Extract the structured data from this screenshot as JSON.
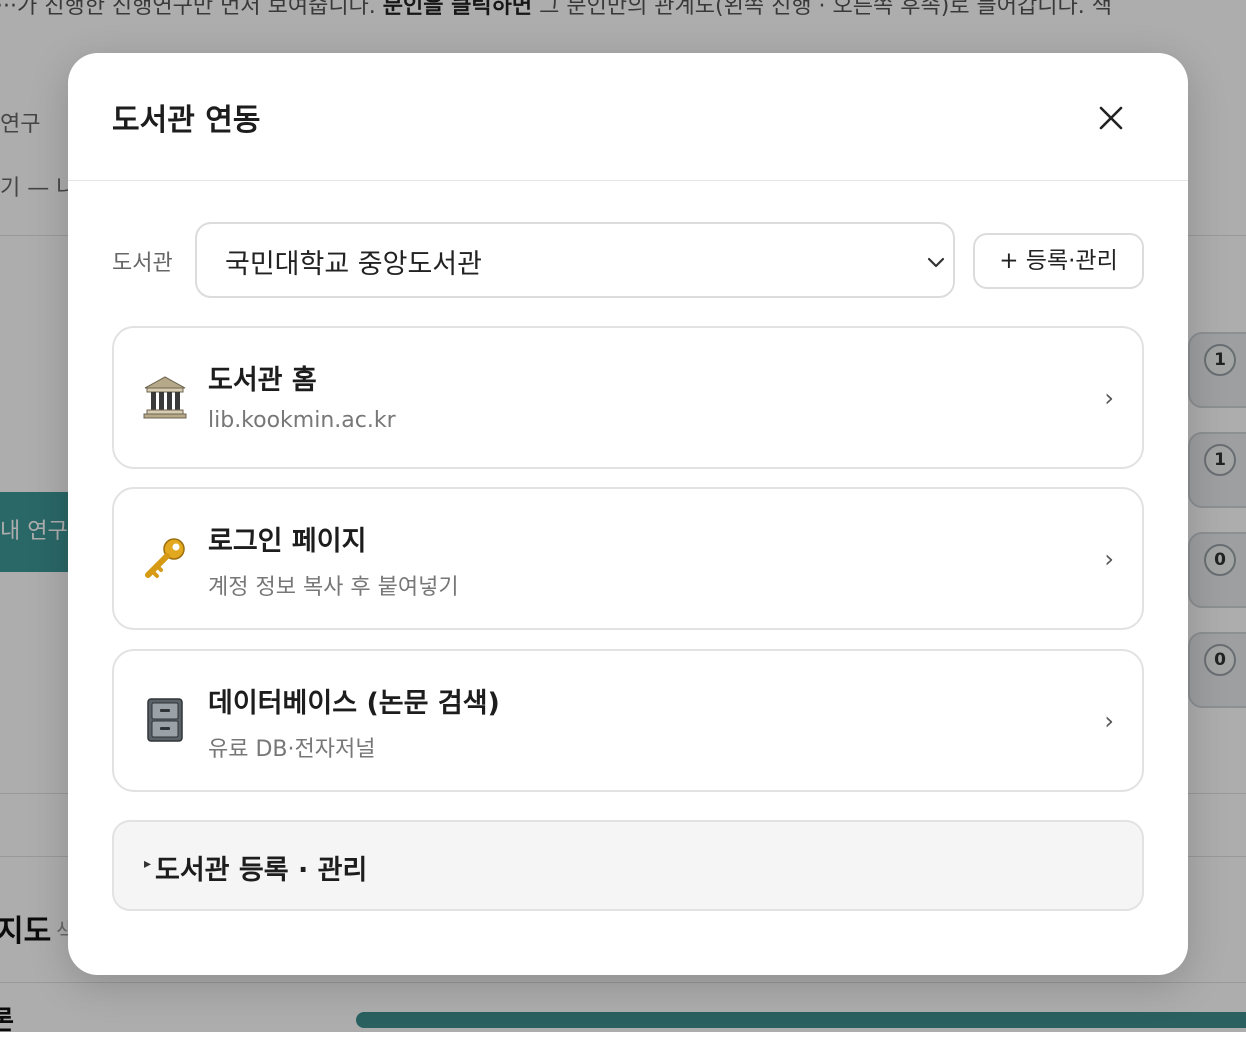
{
  "background": {
    "top_text_prefix": "···가 진행한 진행연구만 먼저 보여줍니다. ",
    "top_text_bold": "분인을 클릭하면",
    "top_text_suffix": " 그 분인만의 관계도(왼쪽 진행 · 오른쪽 후속)로 들어갑니다. 색",
    "left_label_1": "연구",
    "left_label_2": "기 — 나",
    "button_label": "내 연구",
    "counts": [
      "1",
      "1",
      "0",
      "0"
    ],
    "section_title": "지도",
    "section_sub": "색",
    "bottom_label": "론"
  },
  "modal": {
    "title": "도서관 연동",
    "close_icon": "close-icon",
    "library_label": "도서관",
    "library_selected": "국민대학교 중앙도서관",
    "manage_button": "+ 등록·관리",
    "links": [
      {
        "icon": "classical-building-icon",
        "title": "도서관 홈",
        "subtitle": "lib.kookmin.ac.kr",
        "chevron": "›"
      },
      {
        "icon": "key-icon",
        "title": "로그인 페이지",
        "subtitle": "계정 정보 복사 후 붙여넣기",
        "chevron": "›"
      },
      {
        "icon": "file-cabinet-icon",
        "title": "데이터베이스 (논문 검색)",
        "subtitle": "유료 DB·전자저널",
        "chevron": "›"
      }
    ],
    "details_marker": "▸",
    "details_label": "도서관 등록 · 관리"
  },
  "colors": {
    "accent_teal": "#3e9898",
    "overlay": "rgba(0,0,0,0.32)"
  }
}
